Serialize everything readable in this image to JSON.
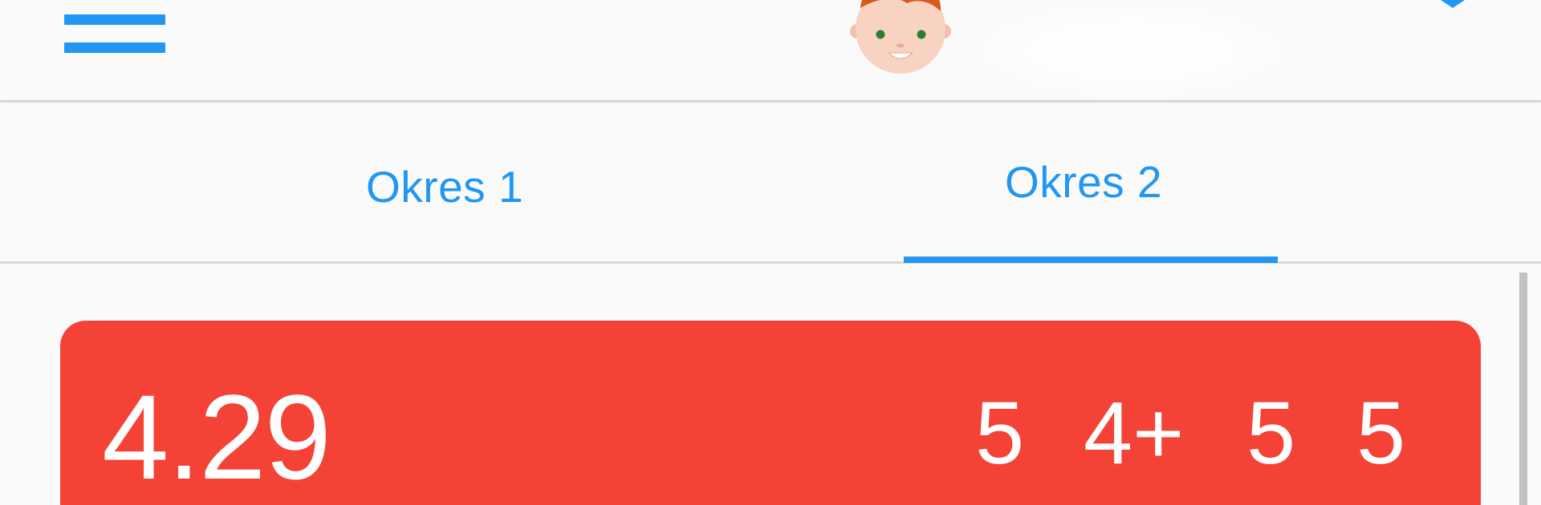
{
  "appbar": {
    "menu_icon": "hamburger-menu-icon",
    "avatar_icon": "boy-avatar-icon",
    "corner_icon": "chevron-down-icon"
  },
  "tabs": [
    {
      "label": "Okres 1",
      "selected": false
    },
    {
      "label": "Okres 2",
      "selected": true
    }
  ],
  "grade_card": {
    "average": "4.29",
    "grades": [
      "5",
      "4+",
      "5",
      "5"
    ]
  },
  "colors": {
    "accent": "#2196f3",
    "card_red": "#f44336",
    "background": "#fafafa",
    "text_on_card": "#ffffff"
  }
}
